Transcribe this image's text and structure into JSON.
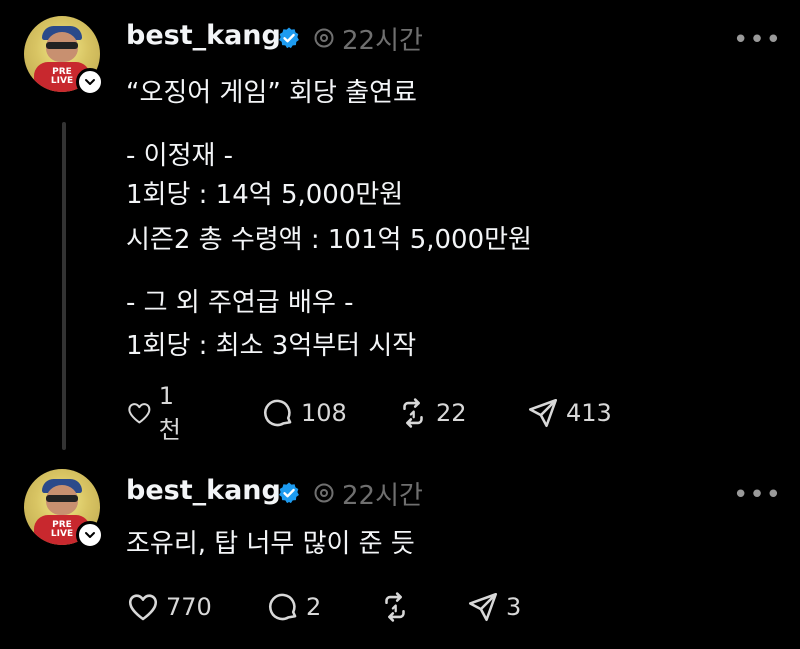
{
  "posts": [
    {
      "username": "best_kang",
      "time": "22시간",
      "lines": [
        "“오징어 게임” 회당 출연료",
        "- 이정재 -",
        "1회당 : 14억 5,000만원",
        "시즌2 총 수령액 : 101억 5,000만원",
        "- 그 외 주연급 배우 -",
        "1회당 : 최소 3억부터 시작"
      ],
      "likes": "1천",
      "replies": "108",
      "reposts": "22",
      "shares": "413"
    },
    {
      "username": "best_kang",
      "time": "22시간",
      "lines": [
        "조유리, 탑 너무 많이 준 듯"
      ],
      "likes": "770",
      "replies": "2",
      "reposts": "",
      "shares": "3"
    }
  ],
  "avatar_text": "PRE LIVE",
  "more_label": "•••",
  "colors": {
    "background": "#000000",
    "text": "#f3f5f7",
    "muted": "#6f6f6f",
    "verified": "#1d9bf0"
  },
  "icons": [
    "verified-icon",
    "threads-icon",
    "heart-icon",
    "reply-icon",
    "repost-icon",
    "share-icon",
    "more-icon",
    "chevron-down-icon"
  ]
}
